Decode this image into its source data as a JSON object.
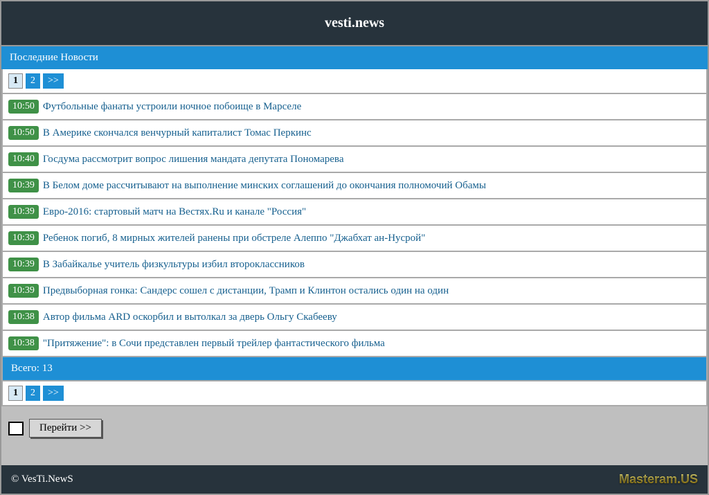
{
  "header": {
    "title": "vesti.news"
  },
  "section_title": "Последние Новости",
  "pager": {
    "pages": [
      "1",
      "2"
    ],
    "next_label": ">>",
    "current": "1"
  },
  "news": [
    {
      "time": "10:50",
      "title": "Футбольные фанаты устроили ночное побоище в Марселе"
    },
    {
      "time": "10:50",
      "title": "В Америке скончался венчурный капиталист Томас Перкинс"
    },
    {
      "time": "10:40",
      "title": "Госдума рассмотрит вопрос лишения мандата депутата Пономарева"
    },
    {
      "time": "10:39",
      "title": "В Белом доме рассчитывают на выполнение минских соглашений до окончания полномочий Обамы"
    },
    {
      "time": "10:39",
      "title": "Евро-2016: стартовый матч на Вестях.Ru и канале \"Россия\""
    },
    {
      "time": "10:39",
      "title": "Ребенок погиб, 8 мирных жителей ранены при обстреле Алеппо \"Джабхат ан-Нусрой\""
    },
    {
      "time": "10:39",
      "title": "В Забайкалье учитель физкультуры избил второклассников"
    },
    {
      "time": "10:39",
      "title": "Предвыборная гонка: Сандерс сошел с дистанции, Трамп и Клинтон остались один на один"
    },
    {
      "time": "10:38",
      "title": "Автор фильма ARD оскорбил и вытолкал за дверь Ольгу Скабееву"
    },
    {
      "time": "10:38",
      "title": "\"Притяжение\": в Сочи представлен первый трейлер фантастического фильма"
    }
  ],
  "total_label": "Всего: 13",
  "goto": {
    "button_label": "Перейти >>",
    "input_value": ""
  },
  "footer": {
    "copyright": "© VesTi.NewS",
    "logo_text": "Masteram.US"
  }
}
